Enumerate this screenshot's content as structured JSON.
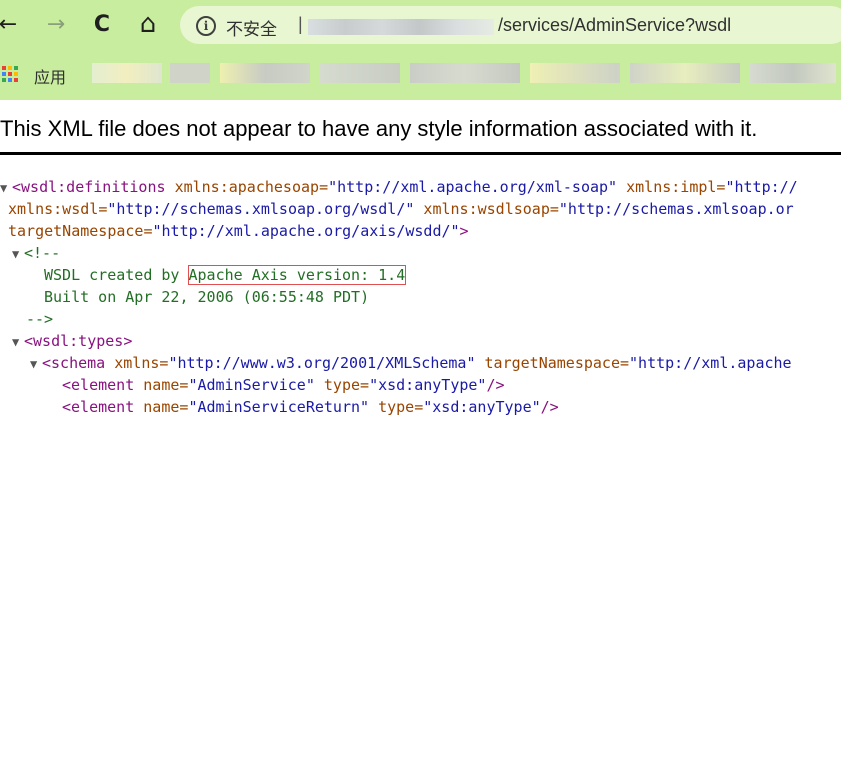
{
  "browser": {
    "nav": {
      "back": "←",
      "forward": "→",
      "reload": "C",
      "home": "⌂"
    },
    "omnibox": {
      "info_icon": "i",
      "security_label": "不安全",
      "separator": "|",
      "url_path": "/services/AdminService?wsdl"
    },
    "bookmarks": {
      "apps_label": "应用"
    }
  },
  "page": {
    "notice": "This XML file does not appear to have any style information associated with it."
  },
  "xml": {
    "toggle": "▼",
    "l1_tag": "<wsdl:definitions",
    "l1_attr1": "xmlns:apachesoap",
    "l1_val1": "\"http://xml.apache.org/xml-soap\"",
    "l1_attr2": "xmlns:impl",
    "l1_val2": "\"http://",
    "l2_attr1": "xmlns:wsdl",
    "l2_val1": "\"http://schemas.xmlsoap.org/wsdl/\"",
    "l2_attr2": "xmlns:wsdlsoap",
    "l2_val2": "\"http://schemas.xmlsoap.or",
    "l3_attr": "targetNamespace",
    "l3_val": "\"http://xml.apache.org/axis/wsdd/\"",
    "l3_close": ">",
    "comment_open": "<!--",
    "comment_line1_a": "WSDL created by ",
    "comment_line1_b": "Apache Axis version: 1.4",
    "comment_line2": "Built on Apr 22, 2006 (06:55:48 PDT)",
    "comment_close": "-->",
    "types_tag": "<wsdl:types>",
    "schema_tag": "<schema",
    "schema_attr1": "xmlns",
    "schema_val1": "\"http://www.w3.org/2001/XMLSchema\"",
    "schema_attr2": "targetNamespace",
    "schema_val2": "\"http://xml.apache",
    "el1_tag": "<element",
    "el1_attr1": "name",
    "el1_val1": "\"AdminService\"",
    "el1_attr2": "type",
    "el1_val2": "\"xsd:anyType\"",
    "el1_close": "/>",
    "el2_tag": "<element",
    "el2_attr1": "name",
    "el2_val1": "\"AdminServiceReturn\"",
    "el2_attr2": "type",
    "el2_val2": "\"xsd:anyType\"",
    "el2_close": "/>",
    "equals": "="
  }
}
